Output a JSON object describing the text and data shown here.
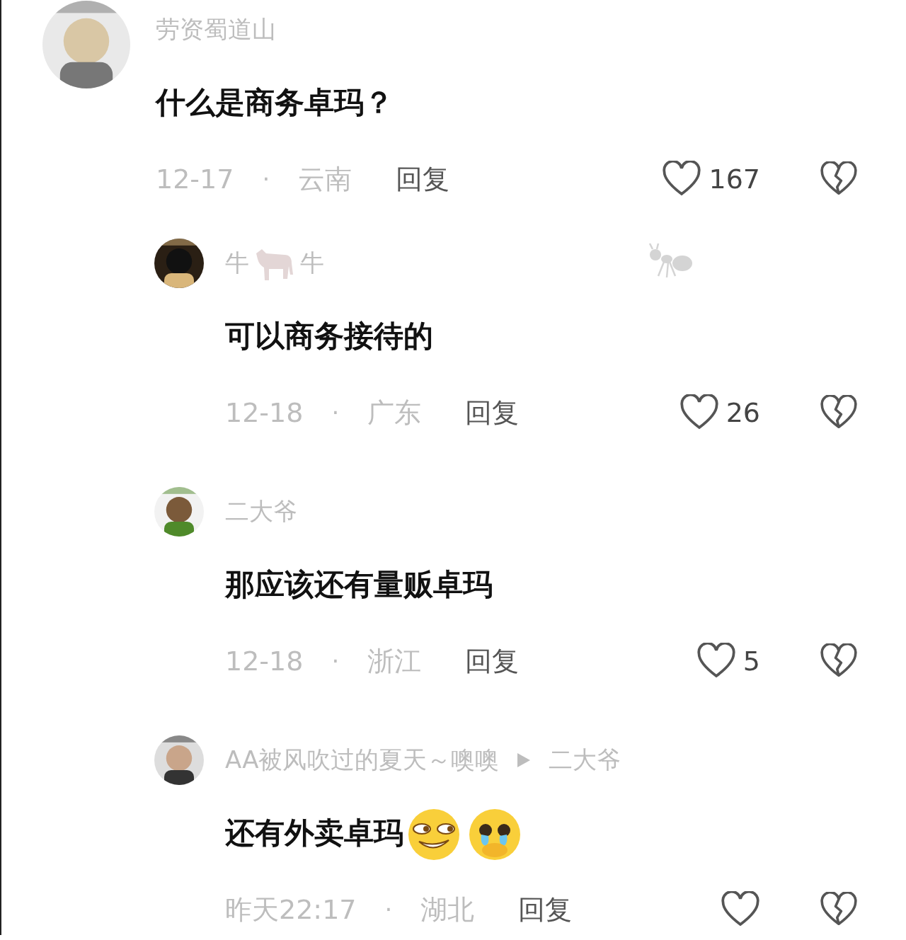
{
  "comments": [
    {
      "kind": "top",
      "avatar": {
        "kind": "picture"
      },
      "name_parts": [
        "劳资蜀道山"
      ],
      "text": "什么是商务卓玛？",
      "date": "12-17",
      "separator": "·",
      "location": "云南",
      "reply_label": "回复",
      "likes": "167"
    },
    {
      "kind": "reply",
      "avatar": {
        "kind": "picture"
      },
      "name_parts": [
        "牛",
        "牛"
      ],
      "has_badge": true,
      "text": "可以商务接待的",
      "date": "12-18",
      "separator": "·",
      "location": "广东",
      "reply_label": "回复",
      "likes": "26"
    },
    {
      "kind": "reply",
      "avatar": {
        "kind": "picture"
      },
      "name_parts": [
        "二大爷"
      ],
      "text": "那应该还有量贩卓玛",
      "date": "12-18",
      "separator": "·",
      "location": "浙江",
      "reply_label": "回复",
      "likes": "5"
    },
    {
      "kind": "reply",
      "avatar": {
        "kind": "picture"
      },
      "name_parts": [
        "AA被风吹过的夏天～噢噢"
      ],
      "reply_to": "二大爷",
      "text": "还有外卖卓玛",
      "emojis": [
        {
          "kind": "smirk"
        },
        {
          "kind": "tearful"
        }
      ],
      "date": "昨天22:17",
      "separator": "·",
      "location": "湖北",
      "reply_label": "回复"
    }
  ]
}
